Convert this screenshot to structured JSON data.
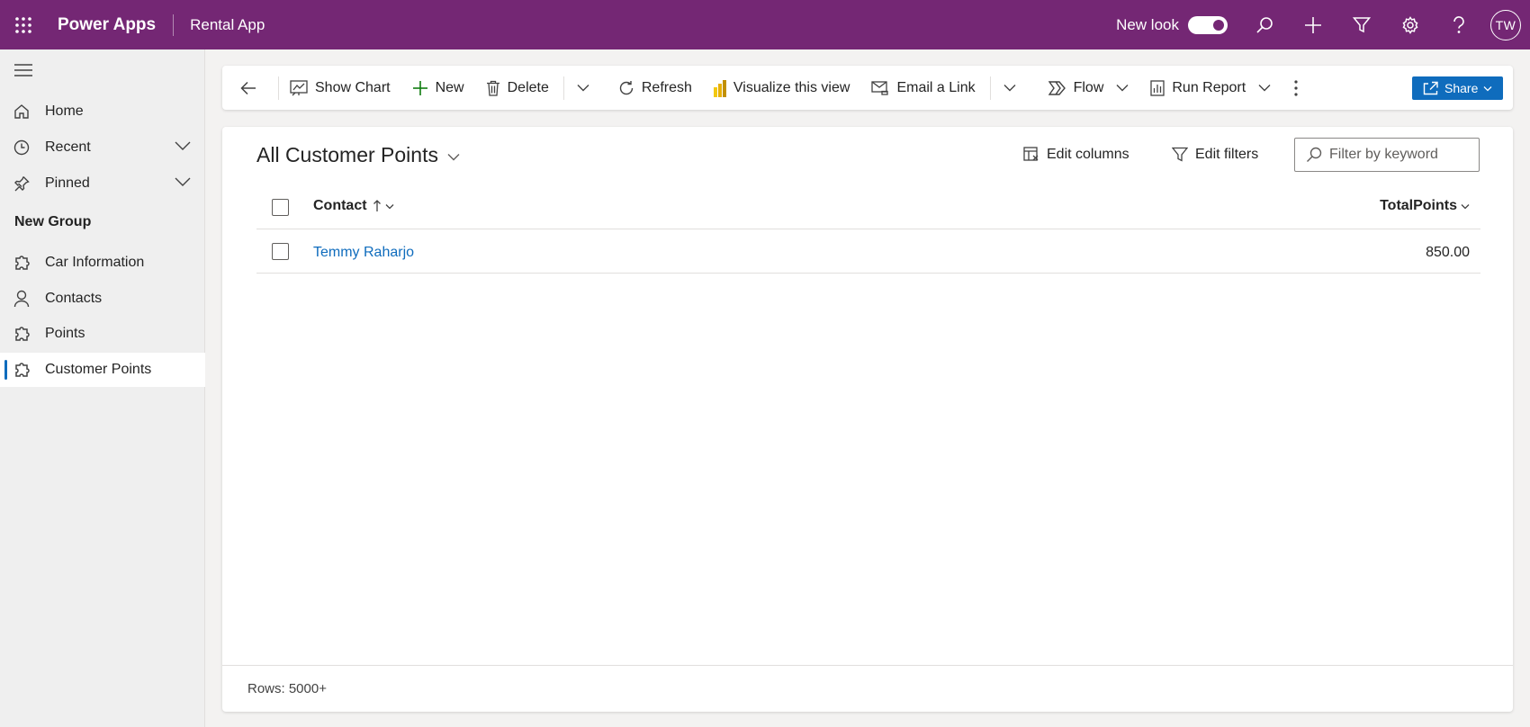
{
  "header": {
    "brand": "Power Apps",
    "app_name": "Rental App",
    "new_look_label": "New look",
    "new_look_on": true,
    "avatar_initials": "TW",
    "icons": [
      "app-launcher-icon",
      "search-icon",
      "plus-icon",
      "filter-icon",
      "settings-icon",
      "help-icon"
    ]
  },
  "sidebar": {
    "top_items": [
      {
        "label": "Home",
        "icon": "home-icon"
      },
      {
        "label": "Recent",
        "icon": "clock-icon",
        "expandable": true
      },
      {
        "label": "Pinned",
        "icon": "pin-icon",
        "expandable": true
      }
    ],
    "group_title": "New Group",
    "group_items": [
      {
        "label": "Car Information",
        "icon": "puzzle-icon"
      },
      {
        "label": "Contacts",
        "icon": "person-icon"
      },
      {
        "label": "Points",
        "icon": "puzzle-icon"
      },
      {
        "label": "Customer Points",
        "icon": "puzzle-icon",
        "selected": true
      }
    ]
  },
  "commandbar": {
    "show_chart": "Show Chart",
    "new": "New",
    "delete": "Delete",
    "refresh": "Refresh",
    "visualize": "Visualize this view",
    "email_link": "Email a Link",
    "flow": "Flow",
    "run_report": "Run Report",
    "share": "Share"
  },
  "view": {
    "title": "All Customer Points",
    "edit_columns": "Edit columns",
    "edit_filters": "Edit filters",
    "search_placeholder": "Filter by keyword",
    "columns": {
      "contact": "Contact",
      "total_points": "TotalPoints"
    },
    "rows": [
      {
        "contact": "Temmy Raharjo",
        "total_points": "850.00"
      }
    ],
    "footer": "Rows: 5000+"
  },
  "colors": {
    "header_bg": "#742774",
    "accent": "#0f6cbd"
  }
}
